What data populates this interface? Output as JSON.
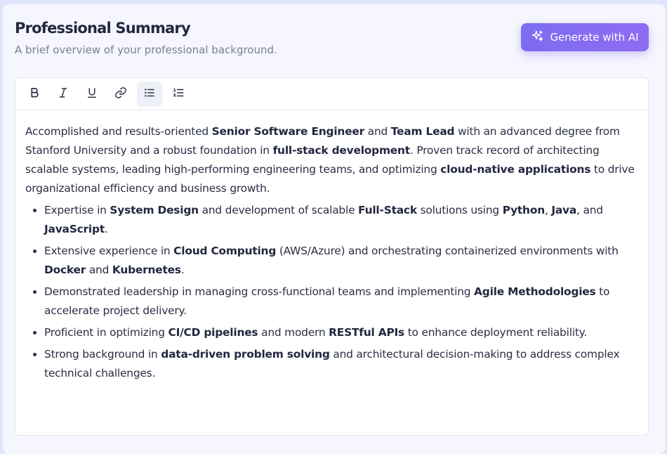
{
  "header": {
    "title": "Professional Summary",
    "subtitle": "A brief overview of your professional background.",
    "generate_label": "Generate with AI"
  },
  "toolbar": {
    "items": [
      {
        "name": "bold",
        "icon": "bold-icon"
      },
      {
        "name": "italic",
        "icon": "italic-icon"
      },
      {
        "name": "underline",
        "icon": "underline-icon"
      },
      {
        "name": "link",
        "icon": "link-icon"
      },
      {
        "name": "bullet-list",
        "icon": "bullet-list-icon",
        "active": true
      },
      {
        "name": "numbered-list",
        "icon": "numbered-list-icon"
      }
    ]
  },
  "summary": {
    "p": [
      "Accomplished and results-oriented ",
      "Senior Software Engineer",
      " and ",
      "Team Lead",
      " with an advanced degree from Stanford University and a robust foundation in ",
      "full-stack development",
      ". Proven track record of architecting scalable systems, leading high-performing engineering teams, and optimizing ",
      "cloud-native applications",
      " to drive organizational efficiency and business growth."
    ],
    "b1": [
      "Expertise in ",
      "System Design",
      " and development of scalable ",
      "Full-Stack",
      " solutions using ",
      "Python",
      ", ",
      "Java",
      ", and ",
      "JavaScript",
      "."
    ],
    "b2": [
      "Extensive experience in ",
      "Cloud Computing",
      " (AWS/Azure) and orchestrating containerized environments with ",
      "Docker",
      " and ",
      "Kubernetes",
      "."
    ],
    "b3": [
      "Demonstrated leadership in managing cross-functional teams and implementing ",
      "Agile Methodologies",
      " to accelerate project delivery."
    ],
    "b4": [
      "Proficient in optimizing ",
      "CI/CD pipelines",
      " and modern ",
      "RESTful APIs",
      " to enhance deployment reliability."
    ],
    "b5": [
      "Strong background in ",
      "data-driven problem solving",
      " and architectural decision-making to address complex technical challenges."
    ]
  },
  "colors": {
    "accent": "#8170f2",
    "text": "#2a2e45",
    "muted": "#7a7f93"
  }
}
